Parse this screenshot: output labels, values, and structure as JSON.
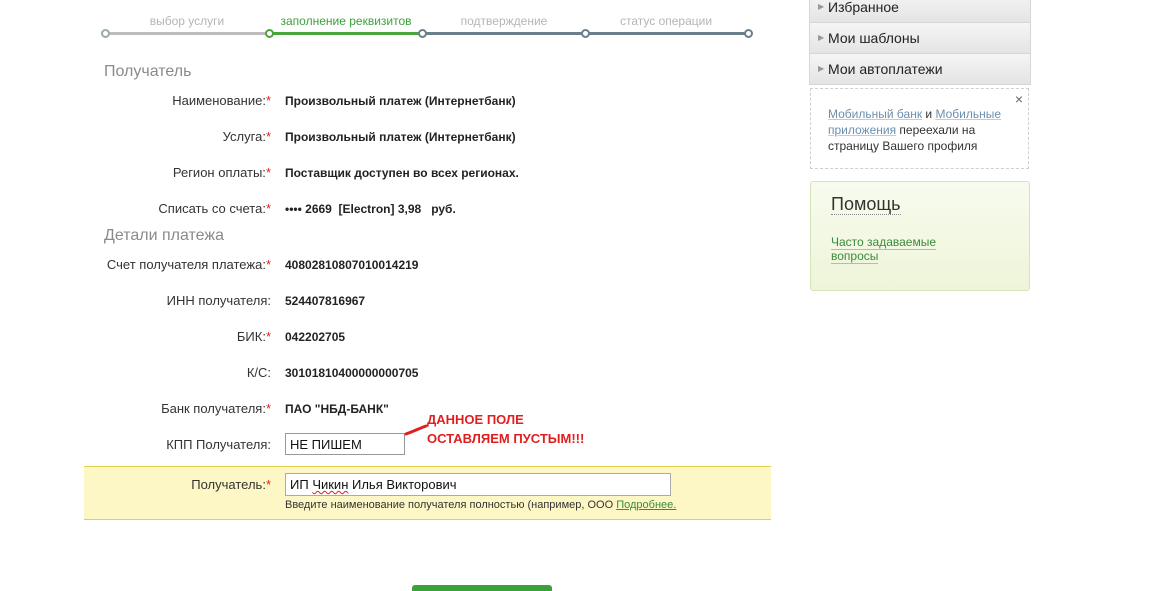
{
  "steps": [
    {
      "label": "выбор услуги",
      "state": "done"
    },
    {
      "label": "заполнение реквизитов",
      "state": "active"
    },
    {
      "label": "подтверждение",
      "state": "pending"
    },
    {
      "label": "статус операции",
      "state": "pending"
    }
  ],
  "recipient_section": {
    "title": "Получатель",
    "rows": [
      {
        "label": "Наименование:",
        "required": true,
        "value": "Произвольный платеж (Интернетбанк)"
      },
      {
        "label": "Услуга:",
        "required": true,
        "value": "Произвольный платеж (Интернетбанк)"
      },
      {
        "label": "Регион оплаты:",
        "required": true,
        "value": "Поставщик доступен во всех регионах."
      },
      {
        "label": "Списать со счета:",
        "required": true,
        "value": "•••• 2669  [Electron] 3,98   руб."
      }
    ]
  },
  "details_section": {
    "title": "Детали платежа",
    "rows": [
      {
        "label": "Счет получателя платежа:",
        "required": true,
        "value": "40802810807010014219"
      },
      {
        "label": "ИНН получателя:",
        "required": false,
        "value": "524407816967"
      },
      {
        "label": "БИК:",
        "required": true,
        "value": "042202705"
      },
      {
        "label": "К/С:",
        "required": false,
        "value": "30101810400000000705"
      },
      {
        "label": "Банк получателя:",
        "required": true,
        "value": "ПАО \"НБД-БАНК\""
      }
    ]
  },
  "kpp": {
    "label": "КПП Получателя:",
    "value": "НЕ ПИШЕМ"
  },
  "annotation": {
    "line1": "ДАННОЕ ПОЛЕ",
    "line2": "ОСТАВЛЯЕМ ПУСТЫМ!!!",
    "color": "#e02020"
  },
  "recipient_field": {
    "label": "Получатель:",
    "value_prefix": "ИП ",
    "value_misspelled": "Чикин",
    "value_suffix": " Илья Викторович",
    "hint": "Введите наименование получателя полностью (например, ООО ",
    "hint_link": "Подробнее."
  },
  "sidebar": {
    "menu": [
      {
        "label": "Избранное"
      },
      {
        "label": "Мои шаблоны"
      },
      {
        "label": "Мои автоплатежи"
      }
    ],
    "info": {
      "link1": "Мобильный банк",
      "and": " и ",
      "link2": "Мобильные приложения",
      "text": " переехали на страницу Вашего профиля",
      "close": "×"
    },
    "help": {
      "title": "Помощь",
      "link": "Часто задаваемые вопросы"
    }
  },
  "colors": {
    "accent_green": "#3aa23a",
    "required_red": "#e02020",
    "highlight": "#fdf7c6"
  }
}
